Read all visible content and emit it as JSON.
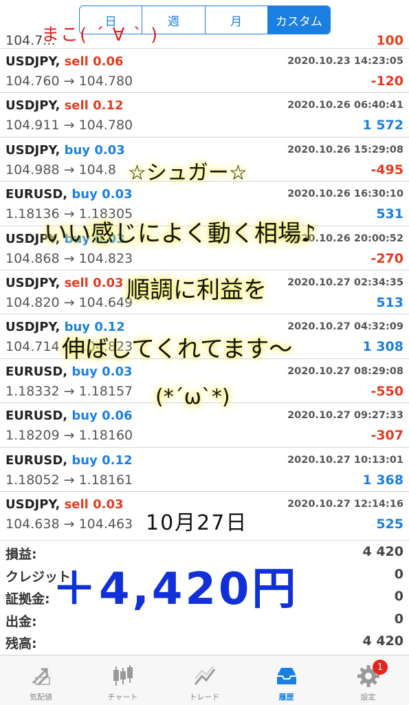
{
  "periods": [
    "日",
    "週",
    "月",
    "カスタム"
  ],
  "active_period": "カスタム",
  "partial_row": {
    "left": "104.7...",
    "right": "100"
  },
  "trades": [
    {
      "symbol": "USDJPY,",
      "side": "sell",
      "volume": "0.06",
      "time": "2020.10.23 14:23:05",
      "prices": "104.760 → 104.780",
      "profit": "-120"
    },
    {
      "symbol": "USDJPY,",
      "side": "sell",
      "volume": "0.12",
      "time": "2020.10.26 06:40:41",
      "prices": "104.911 → 104.780",
      "profit": "1 572"
    },
    {
      "symbol": "USDJPY,",
      "side": "buy",
      "volume": "0.03",
      "time": "2020.10.26 15:29:08",
      "prices": "104.988 → 104.8",
      "profit": "-495"
    },
    {
      "symbol": "EURUSD,",
      "side": "buy",
      "volume": "0.03",
      "time": "2020.10.26 16:30:10",
      "prices": "1.18136 → 1.18305",
      "profit": "531"
    },
    {
      "symbol": "USDJPY,",
      "side": "buy",
      "volume": "0.03",
      "time": "2020.10.26 20:00:52",
      "prices": "104.868 → 104.823",
      "profit": "-270"
    },
    {
      "symbol": "USDJPY,",
      "side": "sell",
      "volume": "0.03",
      "time": "2020.10.27 02:34:35",
      "prices": "104.820 → 104.649",
      "profit": "513"
    },
    {
      "symbol": "USDJPY,",
      "side": "buy",
      "volume": "0.12",
      "time": "2020.10.27 04:32:09",
      "prices": "104.714 → 104.823",
      "profit": "1 308"
    },
    {
      "symbol": "EURUSD,",
      "side": "buy",
      "volume": "0.03",
      "time": "2020.10.27 08:29:08",
      "prices": "1.18332 → 1.18157",
      "profit": "-550"
    },
    {
      "symbol": "EURUSD,",
      "side": "buy",
      "volume": "0.06",
      "time": "2020.10.27 09:27:33",
      "prices": "1.18209 → 1.18160",
      "profit": "-307"
    },
    {
      "symbol": "EURUSD,",
      "side": "buy",
      "volume": "0.12",
      "time": "2020.10.27 10:13:01",
      "prices": "1.18052 → 1.18161",
      "profit": "1 368"
    },
    {
      "symbol": "USDJPY,",
      "side": "sell",
      "volume": "0.03",
      "time": "2020.10.27 12:14:16",
      "prices": "104.638 → 104.463",
      "profit": "525"
    }
  ],
  "summary": [
    {
      "label": "損益:",
      "value": "4 420"
    },
    {
      "label": "クレジット:",
      "value": "0"
    },
    {
      "label": "証拠金:",
      "value": "0"
    },
    {
      "label": "出金:",
      "value": "0"
    },
    {
      "label": "残高:",
      "value": "4 420"
    }
  ],
  "tabs": [
    {
      "label": "気配値",
      "icon": "quotes-icon"
    },
    {
      "label": "チャート",
      "icon": "chart-icon"
    },
    {
      "label": "トレード",
      "icon": "trade-icon"
    },
    {
      "label": "履歴",
      "icon": "history-icon"
    },
    {
      "label": "設定",
      "icon": "settings-icon"
    }
  ],
  "active_tab": "履歴",
  "settings_badge": "1",
  "overlay": {
    "signature": "まこ( ´ ∀ ` )",
    "line1": "☆シュガー☆",
    "line2": "いい感じによく動く相場♪",
    "line3": "順調に利益を",
    "line4": "伸ばしてくれてます〜",
    "line5": "(*´ω`*)",
    "date": "10月27日",
    "total": "＋4,420円"
  },
  "colors": {
    "accent": "#1a7fe0",
    "loss": "#e23a1f",
    "highlight": "#f6f07a",
    "total_ink": "#1030d8"
  }
}
